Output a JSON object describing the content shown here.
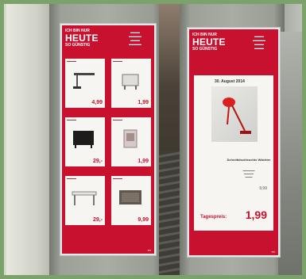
{
  "left_poster": {
    "header_line1": "ICH BIN NUR",
    "header_big": "HEUTE",
    "header_line3": "SO GÜNSTIG",
    "items": [
      {
        "price": "4,99"
      },
      {
        "price": "1,99"
      },
      {
        "price": "29,-"
      },
      {
        "price": "1,99"
      },
      {
        "price": "29,-"
      },
      {
        "price": "9,99"
      }
    ]
  },
  "right_poster": {
    "header_line1": "ICH BIN NUR",
    "header_big": "HEUTE",
    "header_line3": "SO GÜNSTIG",
    "date": "30. August 2014",
    "product_name": "Schreibtischleuchte Wächter",
    "old_price": "9,99",
    "price_label": "Tagespreis:",
    "price": "1,99"
  },
  "colors": {
    "poster_red": "#c7112f",
    "tile_white": "#f6f5f1",
    "frame_green": "#7aa26a"
  }
}
